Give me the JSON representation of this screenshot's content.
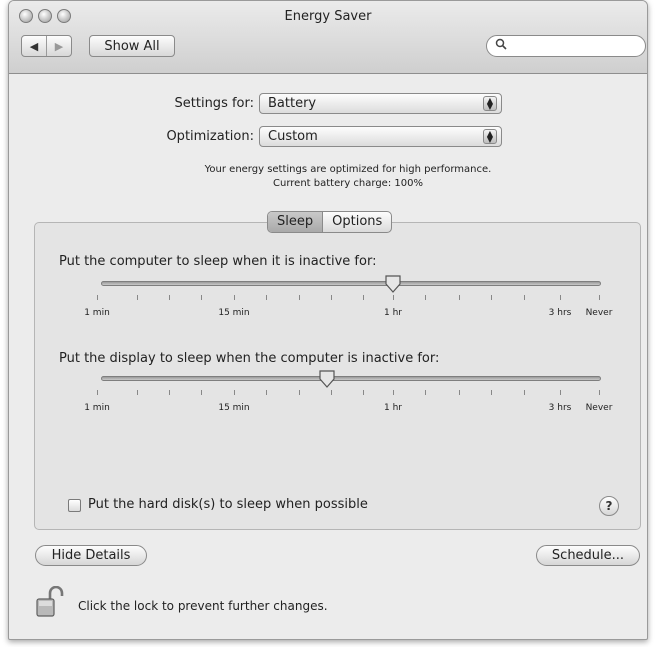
{
  "window": {
    "title": "Energy Saver"
  },
  "toolbar": {
    "back_glyph": "◀",
    "forward_glyph": "▶",
    "show_all_label": "Show All",
    "search_placeholder": "",
    "search_glyph": "⚲"
  },
  "settings": {
    "settings_for_label": "Settings for:",
    "settings_for_value": "Battery",
    "optimization_label": "Optimization:",
    "optimization_value": "Custom",
    "info_line1": "Your energy settings are optimized for high performance.",
    "info_line2": "Current battery charge: 100%"
  },
  "tabs": [
    {
      "label": "Sleep",
      "selected": true
    },
    {
      "label": "Options",
      "selected": false
    }
  ],
  "computer_sleep": {
    "prompt": "Put the computer to sleep when it is inactive for:",
    "labels": {
      "min1": "1 min",
      "min15": "15 min",
      "hr1": "1 hr",
      "hrs3": "3 hrs",
      "never": "Never"
    },
    "value": "1 hr"
  },
  "display_sleep": {
    "prompt": "Put the display to sleep when the computer is inactive for:",
    "labels": {
      "min1": "1 min",
      "min15": "15 min",
      "hr1": "1 hr",
      "hrs3": "3 hrs",
      "never": "Never"
    },
    "value_fraction": 0.47
  },
  "hard_disk": {
    "label": "Put the hard disk(s) to sleep when possible",
    "checked": false
  },
  "help_label": "?",
  "buttons": {
    "hide_details": "Hide Details",
    "schedule": "Schedule..."
  },
  "lock": {
    "text": "Click the lock to prevent further changes."
  }
}
